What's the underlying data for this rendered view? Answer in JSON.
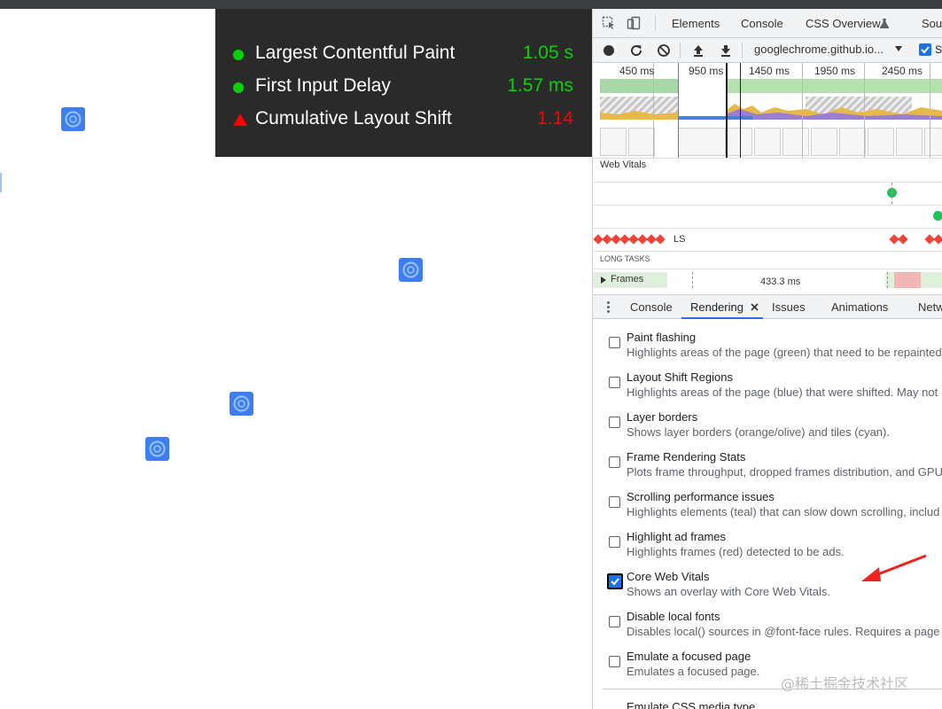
{
  "vitals": {
    "items": [
      {
        "label": "Largest Contentful Paint",
        "value": "1.05 s",
        "status": "good"
      },
      {
        "label": "First Input Delay",
        "value": "1.57 ms",
        "status": "good"
      },
      {
        "label": "Cumulative Layout Shift",
        "value": "1.14",
        "status": "poor"
      }
    ],
    "colors": {
      "good": "#0ccf0c",
      "poor": "#ff0000"
    }
  },
  "devtools": {
    "tabs": [
      "Elements",
      "Console",
      "CSS Overview",
      "Sou"
    ],
    "toolbar": {
      "url": "googlechrome.github.io...",
      "checkbox_label": "S"
    },
    "timeline": {
      "ticks": [
        "450 ms",
        "950 ms",
        "1450 ms",
        "1950 ms",
        "2450 ms"
      ],
      "tracks": {
        "web_vitals": "Web Vitals",
        "ls": "LS",
        "long_tasks": "LONG TASKS",
        "frames": "Frames",
        "frames_duration": "433.3 ms"
      }
    },
    "drawer": {
      "tabs": [
        "Console",
        "Rendering",
        "Issues",
        "Animations",
        "Netw"
      ],
      "active_tab": "Rendering"
    },
    "rendering_options": [
      {
        "title": "Paint flashing",
        "desc": "Highlights areas of the page (green) that need to be repainted",
        "checked": false
      },
      {
        "title": "Layout Shift Regions",
        "desc": "Highlights areas of the page (blue) that were shifted. May not",
        "checked": false
      },
      {
        "title": "Layer borders",
        "desc": "Shows layer borders (orange/olive) and tiles (cyan).",
        "checked": false
      },
      {
        "title": "Frame Rendering Stats",
        "desc": "Plots frame throughput, dropped frames distribution, and GPU",
        "checked": false
      },
      {
        "title": "Scrolling performance issues",
        "desc": "Highlights elements (teal) that can slow down scrolling, includ",
        "checked": false
      },
      {
        "title": "Highlight ad frames",
        "desc": "Highlights frames (red) detected to be ads.",
        "checked": false
      },
      {
        "title": "Core Web Vitals",
        "desc": "Shows an overlay with Core Web Vitals.",
        "checked": true
      },
      {
        "title": "Disable local fonts",
        "desc": "Disables local() sources in @font-face rules. Requires a page r",
        "checked": false
      },
      {
        "title": "Emulate a focused page",
        "desc": "Emulates a focused page.",
        "checked": false
      }
    ],
    "last_option_partial": "Emulate CSS media type"
  },
  "watermark": "@稀土掘金技术社区",
  "icons": [
    "chrome-logo-icon",
    "inspect-icon",
    "device-toolbar-icon",
    "record-icon",
    "reload-icon",
    "clear-icon",
    "upload-icon",
    "download-icon",
    "close-icon",
    "kebab-menu-icon",
    "checkbox-checked-icon",
    "arrow-annotation-icon"
  ]
}
